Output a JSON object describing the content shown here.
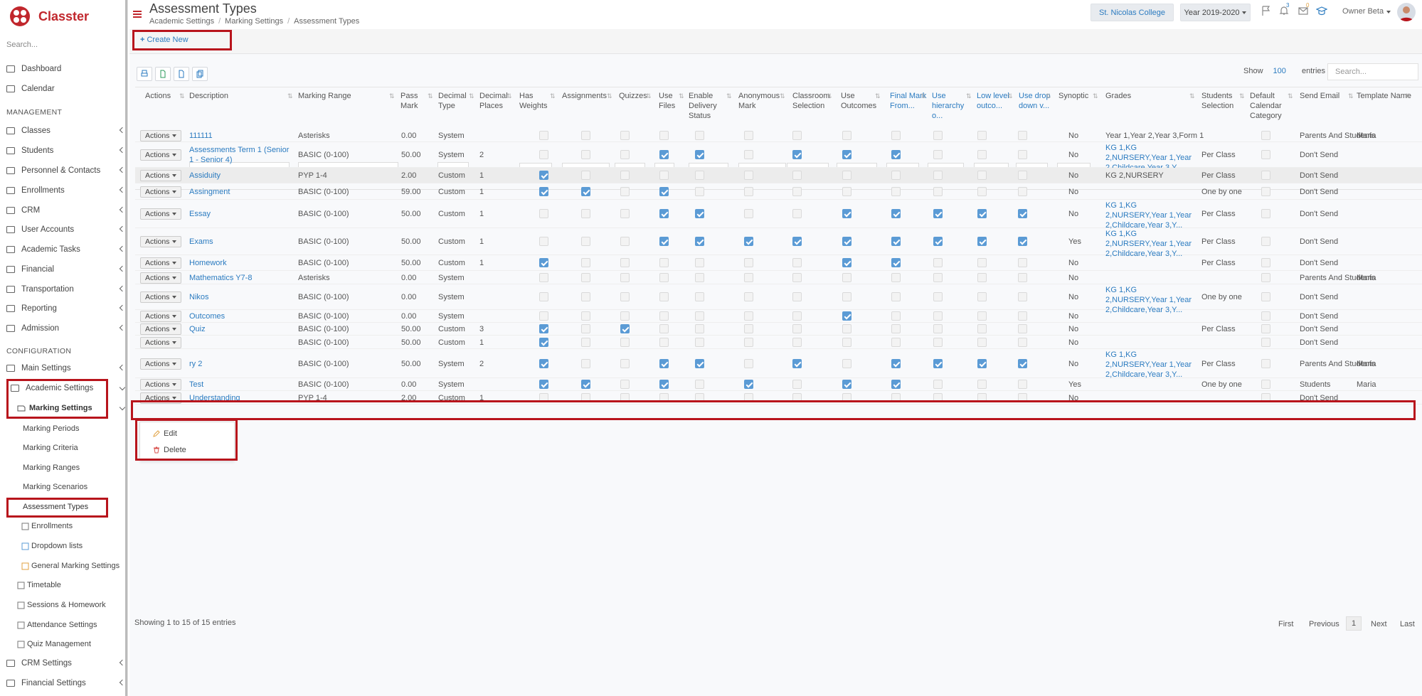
{
  "app": {
    "name": "Classter"
  },
  "sidebar": {
    "search_placeholder": "Search...",
    "items": [
      {
        "label": "Dashboard",
        "icon": "laptop-icon"
      },
      {
        "label": "Calendar",
        "icon": "calendar-icon"
      },
      {
        "label": "Classes",
        "icon": "classes-icon"
      },
      {
        "label": "Students",
        "icon": "students-icon"
      },
      {
        "label": "Personnel & Contacts",
        "icon": "personnel-icon"
      },
      {
        "label": "Enrollments",
        "icon": "enrollments-icon"
      },
      {
        "label": "CRM",
        "icon": "crm-icon"
      },
      {
        "label": "User Accounts",
        "icon": "key-icon"
      },
      {
        "label": "Academic Tasks",
        "icon": "tasks-icon"
      },
      {
        "label": "Financial",
        "icon": "financial-icon"
      },
      {
        "label": "Transportation",
        "icon": "bus-icon"
      },
      {
        "label": "Reporting",
        "icon": "reporting-icon"
      },
      {
        "label": "Admission",
        "icon": "admission-icon"
      },
      {
        "label": "Main Settings",
        "icon": "sliders-icon"
      },
      {
        "label": "Academic Settings",
        "icon": "academic-icon"
      },
      {
        "label": "CRM Settings",
        "icon": "crm-icon"
      },
      {
        "label": "Financial Settings",
        "icon": "financial-icon"
      }
    ],
    "sections": {
      "management": "MANAGEMENT",
      "configuration": "CONFIGURATION"
    },
    "marking_settings": "Marking Settings",
    "marking_sub": [
      "Marking Periods",
      "Marking Criteria",
      "Marking Ranges",
      "Marking Scenarios",
      "Assessment Types"
    ],
    "academic_sub": [
      "Enrollments",
      "Dropdown lists",
      "General Marking Settings",
      "Timetable",
      "Sessions & Homework",
      "Attendance Settings",
      "Quiz Management"
    ]
  },
  "header": {
    "title": "Assessment Types",
    "breadcrumb": [
      "Academic Settings",
      "Marking Settings",
      "Assessment Types"
    ],
    "school": "St. Nicolas College",
    "year": "Year 2019-2020",
    "notif_count": "3",
    "msg_count": "0",
    "user": "Owner Beta"
  },
  "toolbar": {
    "create": "Create New"
  },
  "table_controls": {
    "show": "Show",
    "show_count": "100",
    "entries": "entries",
    "search_placeholder": "Search..."
  },
  "columns": [
    "Actions",
    "Description",
    "Marking Range",
    "Pass Mark",
    "Decimal Type",
    "Decimal Places",
    "Has Weights",
    "Assignments",
    "Quizzes",
    "Use Files",
    "Enable Delivery Status",
    "Anonymous Mark",
    "Classroom Selection",
    "Use Outcomes",
    "Final Mark From...",
    "Use hierarchy o...",
    "Low level outco...",
    "Use drop down v...",
    "Synoptic",
    "Grades",
    "Students Selection",
    "Default Calendar Category",
    "Send Email",
    "Template Name"
  ],
  "filters": {
    "description": "Description",
    "marking_range": "Marking Range"
  },
  "action_label": "Actions",
  "rows": [
    {
      "desc": "111111",
      "range": "Asterisks",
      "pass": "0.00",
      "dtype": "System",
      "places": "",
      "checks": [
        0,
        0,
        0,
        0,
        0,
        0,
        0,
        0,
        0,
        0,
        0,
        0
      ],
      "syn": "No",
      "grades": "Year 1,Year 2,Year 3,Form 1",
      "sel": "",
      "cal": 0,
      "email": "Parents And Students",
      "tpl": "Maria"
    },
    {
      "desc": "Assessments Term 1 (Senior 1 - Senior 4)",
      "range": "BASIC (0-100)",
      "pass": "50.00",
      "dtype": "System",
      "places": "2",
      "checks": [
        0,
        0,
        0,
        1,
        1,
        0,
        1,
        1,
        1,
        0,
        0,
        0
      ],
      "syn": "No",
      "grades": "KG 1,KG 2,NURSERY,Year 1,Year 2,Childcare,Year 3,Y...",
      "sel": "Per Class",
      "cal": 0,
      "email": "Don't Send",
      "tpl": ""
    },
    {
      "desc": "Assiduity",
      "range": "PYP 1-4",
      "pass": "2.00",
      "dtype": "Custom",
      "places": "1",
      "checks": [
        1,
        0,
        0,
        0,
        0,
        0,
        0,
        0,
        0,
        0,
        0,
        0
      ],
      "syn": "No",
      "grades": "KG 2,NURSERY",
      "sel": "Per Class",
      "cal": 0,
      "email": "Don't Send",
      "tpl": ""
    },
    {
      "desc": "Assingment",
      "range": "BASIC (0-100)",
      "pass": "59.00",
      "dtype": "Custom",
      "places": "1",
      "checks": [
        1,
        1,
        0,
        1,
        0,
        0,
        0,
        0,
        0,
        0,
        0,
        0
      ],
      "syn": "No",
      "grades": "",
      "sel": "One by one",
      "cal": 0,
      "email": "Don't Send",
      "tpl": ""
    },
    {
      "desc": "Essay",
      "range": "BASIC (0-100)",
      "pass": "50.00",
      "dtype": "Custom",
      "places": "1",
      "checks": [
        0,
        0,
        0,
        1,
        1,
        0,
        0,
        1,
        1,
        1,
        1,
        1
      ],
      "syn": "No",
      "grades": "KG 1,KG 2,NURSERY,Year 1,Year 2,Childcare,Year 3,Y...",
      "sel": "Per Class",
      "cal": 0,
      "email": "Don't Send",
      "tpl": ""
    },
    {
      "desc": "Exams",
      "range": "BASIC (0-100)",
      "pass": "50.00",
      "dtype": "Custom",
      "places": "1",
      "checks": [
        0,
        0,
        0,
        1,
        1,
        1,
        1,
        1,
        1,
        1,
        1,
        1
      ],
      "syn": "Yes",
      "grades": "KG 1,KG 2,NURSERY,Year 1,Year 2,Childcare,Year 3,Y...",
      "sel": "Per Class",
      "cal": 0,
      "email": "Don't Send",
      "tpl": ""
    },
    {
      "desc": "Homework",
      "range": "BASIC (0-100)",
      "pass": "50.00",
      "dtype": "Custom",
      "places": "1",
      "checks": [
        1,
        0,
        0,
        0,
        0,
        0,
        0,
        1,
        1,
        0,
        0,
        0
      ],
      "syn": "No",
      "grades": "",
      "sel": "Per Class",
      "cal": 0,
      "email": "Don't Send",
      "tpl": ""
    },
    {
      "desc": "Mathematics Y7-8",
      "range": "Asterisks",
      "pass": "0.00",
      "dtype": "System",
      "places": "",
      "checks": [
        0,
        0,
        0,
        0,
        0,
        0,
        0,
        0,
        0,
        0,
        0,
        0
      ],
      "syn": "No",
      "grades": "",
      "sel": "",
      "cal": 0,
      "email": "Parents And Students",
      "tpl": "Maria"
    },
    {
      "desc": "Nikos",
      "range": "BASIC (0-100)",
      "pass": "0.00",
      "dtype": "System",
      "places": "",
      "checks": [
        0,
        0,
        0,
        0,
        0,
        0,
        0,
        0,
        0,
        0,
        0,
        0
      ],
      "syn": "No",
      "grades": "KG 1,KG 2,NURSERY,Year 1,Year 2,Childcare,Year 3,Y...",
      "sel": "One by one",
      "cal": 0,
      "email": "Don't Send",
      "tpl": ""
    },
    {
      "desc": "Outcomes",
      "range": "BASIC (0-100)",
      "pass": "0.00",
      "dtype": "System",
      "places": "",
      "checks": [
        0,
        0,
        0,
        0,
        0,
        0,
        0,
        1,
        0,
        0,
        0,
        0
      ],
      "syn": "No",
      "grades": "",
      "sel": "",
      "cal": 0,
      "email": "Don't Send",
      "tpl": ""
    },
    {
      "desc": "Quiz",
      "range": "BASIC (0-100)",
      "pass": "50.00",
      "dtype": "Custom",
      "places": "3",
      "checks": [
        1,
        0,
        1,
        0,
        0,
        0,
        0,
        0,
        0,
        0,
        0,
        0
      ],
      "syn": "No",
      "grades": "",
      "sel": "Per Class",
      "cal": 0,
      "email": "Don't Send",
      "tpl": ""
    },
    {
      "desc": "",
      "range": "BASIC (0-100)",
      "pass": "50.00",
      "dtype": "Custom",
      "places": "1",
      "checks": [
        1,
        0,
        0,
        0,
        0,
        0,
        0,
        0,
        0,
        0,
        0,
        0
      ],
      "syn": "No",
      "grades": "",
      "sel": "",
      "cal": 0,
      "email": "Don't Send",
      "tpl": ""
    },
    {
      "desc": "ry 2",
      "range": "BASIC (0-100)",
      "pass": "50.00",
      "dtype": "System",
      "places": "2",
      "checks": [
        1,
        0,
        0,
        1,
        1,
        0,
        1,
        0,
        1,
        1,
        1,
        1
      ],
      "syn": "No",
      "grades": "KG 1,KG 2,NURSERY,Year 1,Year 2,Childcare,Year 3,Y...",
      "sel": "Per Class",
      "cal": 0,
      "email": "Parents And Students",
      "tpl": "Maria"
    },
    {
      "desc": "Test",
      "range": "BASIC (0-100)",
      "pass": "0.00",
      "dtype": "System",
      "places": "",
      "checks": [
        1,
        1,
        0,
        1,
        0,
        1,
        0,
        1,
        1,
        0,
        0,
        0
      ],
      "syn": "Yes",
      "grades": "",
      "sel": "One by one",
      "cal": 0,
      "email": "Students",
      "tpl": "Maria"
    },
    {
      "desc": "Understanding",
      "range": "PYP 1-4",
      "pass": "2.00",
      "dtype": "Custom",
      "places": "1",
      "checks": [
        0,
        0,
        0,
        0,
        0,
        0,
        0,
        0,
        0,
        0,
        0,
        0
      ],
      "syn": "No",
      "grades": "",
      "sel": "",
      "cal": 0,
      "email": "Don't Send",
      "tpl": ""
    }
  ],
  "dropdown": {
    "edit": "Edit",
    "delete": "Delete"
  },
  "footer": {
    "showing": "Showing 1 to 15 of 15 entries",
    "first": "First",
    "previous": "Previous",
    "page": "1",
    "next": "Next",
    "last": "Last"
  },
  "colors": {
    "brand": "#c1272d",
    "link": "#2b7bc0",
    "highlight": "#b8141c",
    "checked": "#5b9bd5"
  }
}
